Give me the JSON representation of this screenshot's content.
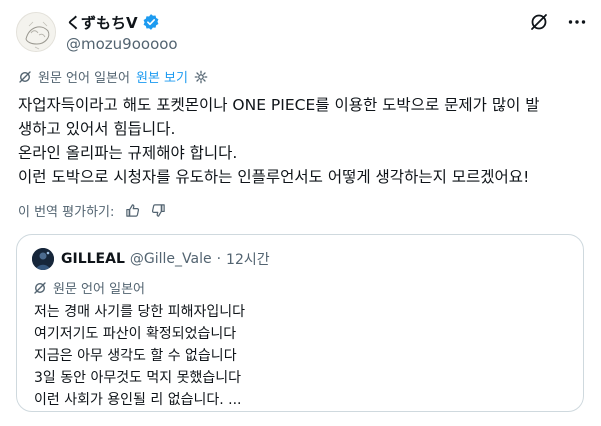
{
  "author": {
    "display_name": "くずもちV",
    "handle": "@mozu9ooooo",
    "verified_icon": "verified-badge-icon"
  },
  "top_icons": [
    "grok-slash-icon",
    "more-options-icon"
  ],
  "translation": {
    "label": "원문 언어 일본어",
    "show_original": "원본 보기"
  },
  "tweet_lines": [
    "자업자득이라고 해도 포켓몬이나 ONE PIECE를 이용한 도박으로 문제가 많이 발",
    "생하고 있어서 힘듭니다.",
    "온라인 올리파는 규제해야 합니다.",
    "이런 도박으로 시청자를 유도하는 인플루언서도 어떻게 생각하는지 모르겠어요!"
  ],
  "rating": {
    "label": "이 번역 평가하기:"
  },
  "quote": {
    "display_name": "GILLEAL",
    "handle": "@Gille_Vale",
    "separator": "·",
    "time": "12시간",
    "translation_label": "원문 언어 일본어",
    "lines": [
      "저는 경매 사기를 당한 피해자입니다",
      "여기저기도 파산이 확정되었습니다",
      "지금은 아무 생각도 할 수 없습니다",
      "3일 동안 아무것도 먹지 못했습니다",
      "이런 사회가 용인될 리 없습니다.  ..."
    ]
  },
  "colors": {
    "text": "#0f1419",
    "muted": "#536471",
    "accent": "#1d9bf0",
    "border": "#cfd9de"
  }
}
